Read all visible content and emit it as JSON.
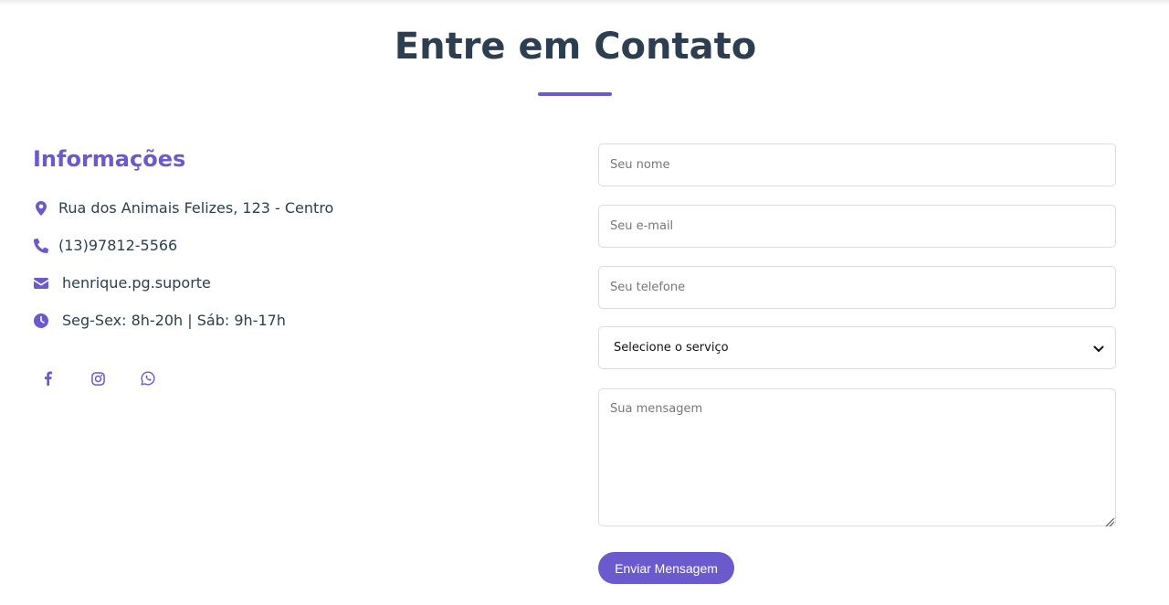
{
  "section": {
    "title": "Entre em Contato"
  },
  "info": {
    "heading": "Informações",
    "items": [
      {
        "icon": "map-pin-icon",
        "text": "Rua dos Animais Felizes, 123 - Centro"
      },
      {
        "icon": "phone-icon",
        "text": "(13)97812-5566"
      },
      {
        "icon": "envelope-icon",
        "text": "henrique.pg.suporte"
      },
      {
        "icon": "clock-icon",
        "text": "Seg-Sex: 8h-20h | Sáb: 9h-17h"
      }
    ]
  },
  "social": [
    {
      "icon": "facebook-icon"
    },
    {
      "icon": "instagram-icon"
    },
    {
      "icon": "whatsapp-icon"
    }
  ],
  "form": {
    "name_placeholder": "Seu nome",
    "email_placeholder": "Seu e-mail",
    "phone_placeholder": "Seu telefone",
    "service_selected": "Selecione o serviço",
    "message_placeholder": "Sua mensagem",
    "submit_label": "Enviar Mensagem"
  },
  "colors": {
    "accent": "#6a5acd",
    "heading": "#2c3e50",
    "border": "#dcdcdc"
  }
}
